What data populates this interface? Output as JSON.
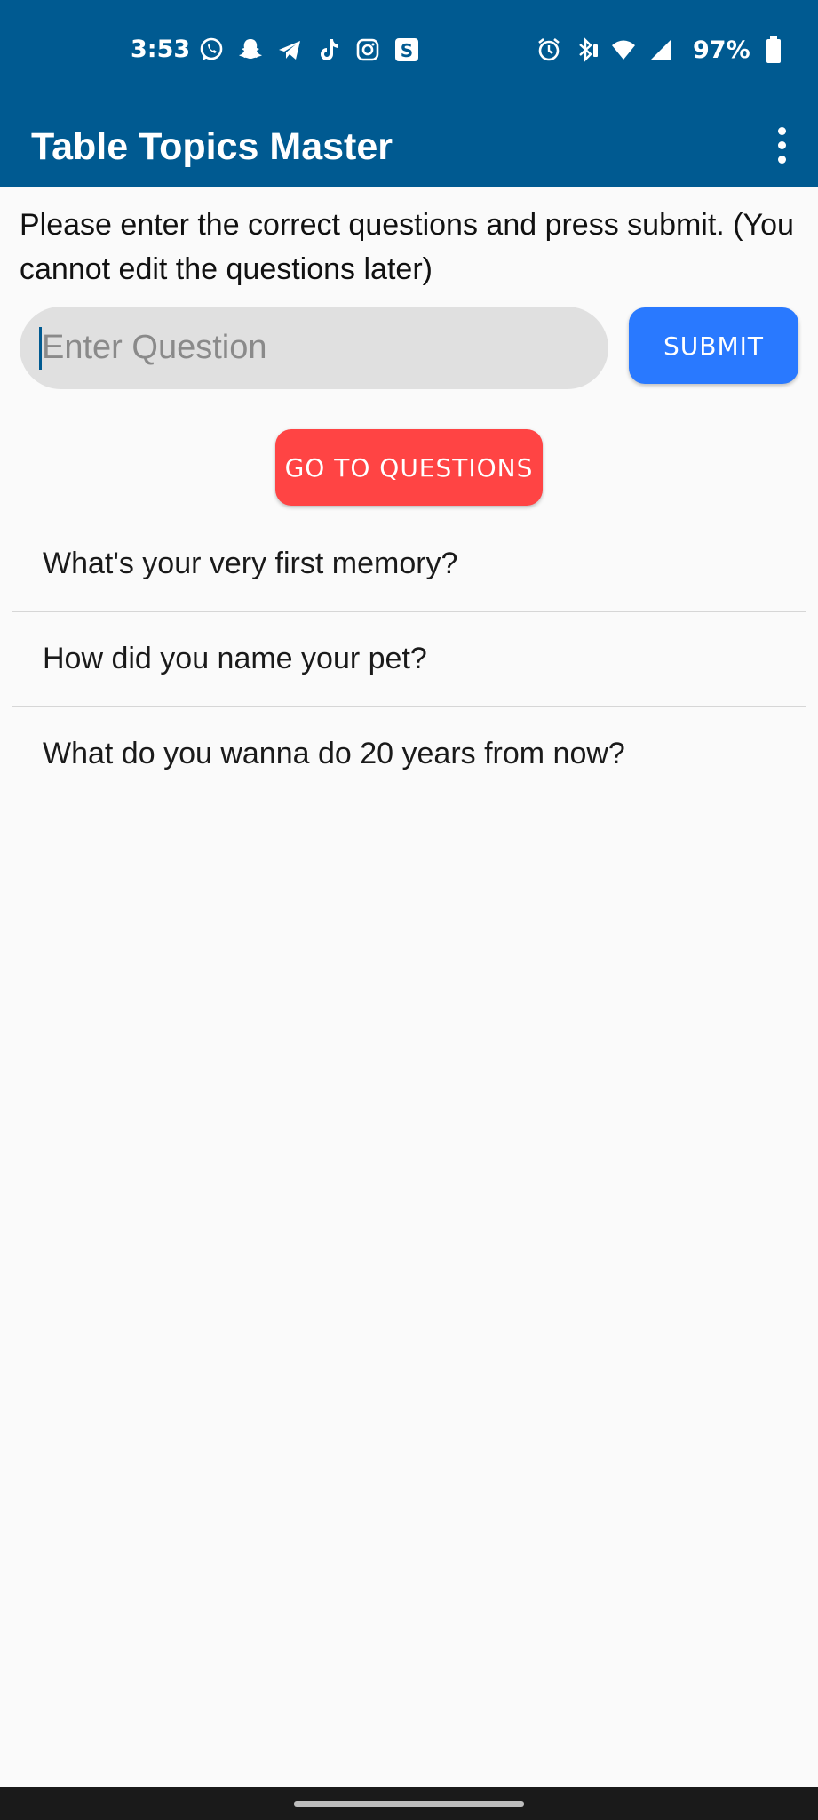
{
  "status_bar": {
    "time": "3:53",
    "battery": "97%",
    "left_icons": [
      "whatsapp-icon",
      "snapchat-icon",
      "telegram-icon",
      "tiktok-icon",
      "instagram-icon",
      "s-app-icon"
    ],
    "right_icons": [
      "alarm-icon",
      "bluetooth-icon",
      "wifi-icon",
      "signal-icon",
      "battery-icon"
    ]
  },
  "app_bar": {
    "title": "Table Topics Master",
    "menu_icon": "more-vert-icon"
  },
  "main": {
    "instructions": "Please enter the correct questions and press submit. (You cannot edit the questions later)",
    "input": {
      "placeholder": "Enter Question",
      "value": ""
    },
    "submit_label": "SUBMIT",
    "go_label": "GO TO QUESTIONS",
    "questions": [
      {
        "text": "What's your very first memory?"
      },
      {
        "text": "How did you name your pet?"
      },
      {
        "text": "What do you wanna do 20 years from now?"
      }
    ]
  },
  "colors": {
    "primary": "#005A91",
    "submit": "#2979FF",
    "go": "#FF4444",
    "background": "#FAFAFA"
  }
}
